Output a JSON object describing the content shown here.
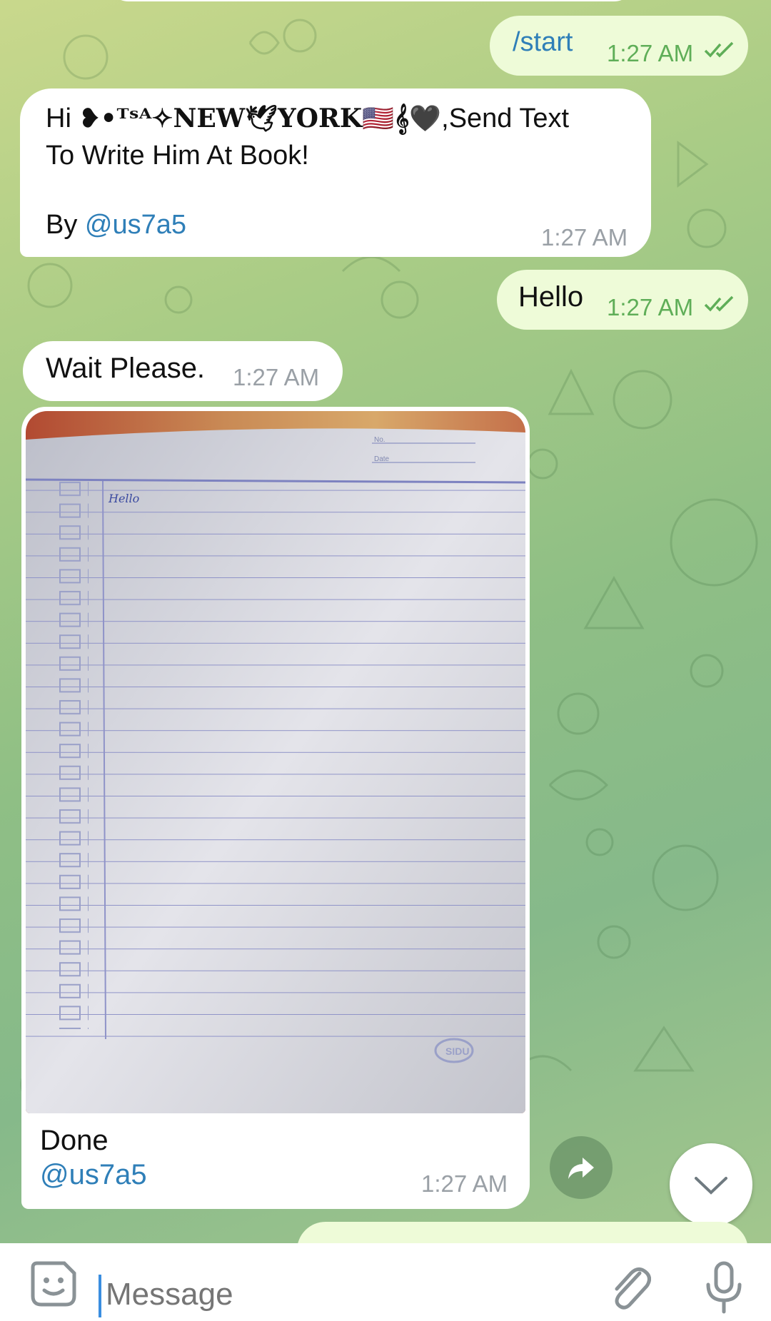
{
  "messages": [
    {
      "id": "start",
      "side": "out",
      "text": "/start",
      "time": "1:27 AM"
    },
    {
      "id": "welcome",
      "side": "in",
      "line1_prefix": "Hi ",
      "line1_fancy": "❥•ᵁˢᴬ✧NEW🕊YORK🇺🇸𝄞🖤",
      "line1_suffix": ",Send Text",
      "line2": "To Write Him At Book!",
      "by_label": "By ",
      "by_handle": "@us7a5",
      "time": "1:27 AM"
    },
    {
      "id": "hello",
      "side": "out",
      "text": "Hello",
      "time": "1:27 AM"
    },
    {
      "id": "wait",
      "side": "in",
      "text": "Wait Please.",
      "time": "1:27 AM"
    },
    {
      "id": "photo",
      "side": "in",
      "page_heading": "Hello",
      "page_labels": {
        "no": "No.",
        "date": "Date"
      },
      "stamp": "SIDU",
      "caption": "Done",
      "handle": "@us7a5",
      "time": "1:27 AM"
    }
  ],
  "composer": {
    "placeholder": "Message"
  },
  "icons": {
    "emoji": "sticker-smile-icon",
    "attach": "paperclip-icon",
    "mic": "microphone-icon",
    "share": "share-arrow-icon",
    "scroll": "chevron-down-icon"
  },
  "colors": {
    "incoming": "#ffffff",
    "outgoing": "#eefbd8",
    "link": "#2f7fb8",
    "time_out": "#5fae58"
  }
}
